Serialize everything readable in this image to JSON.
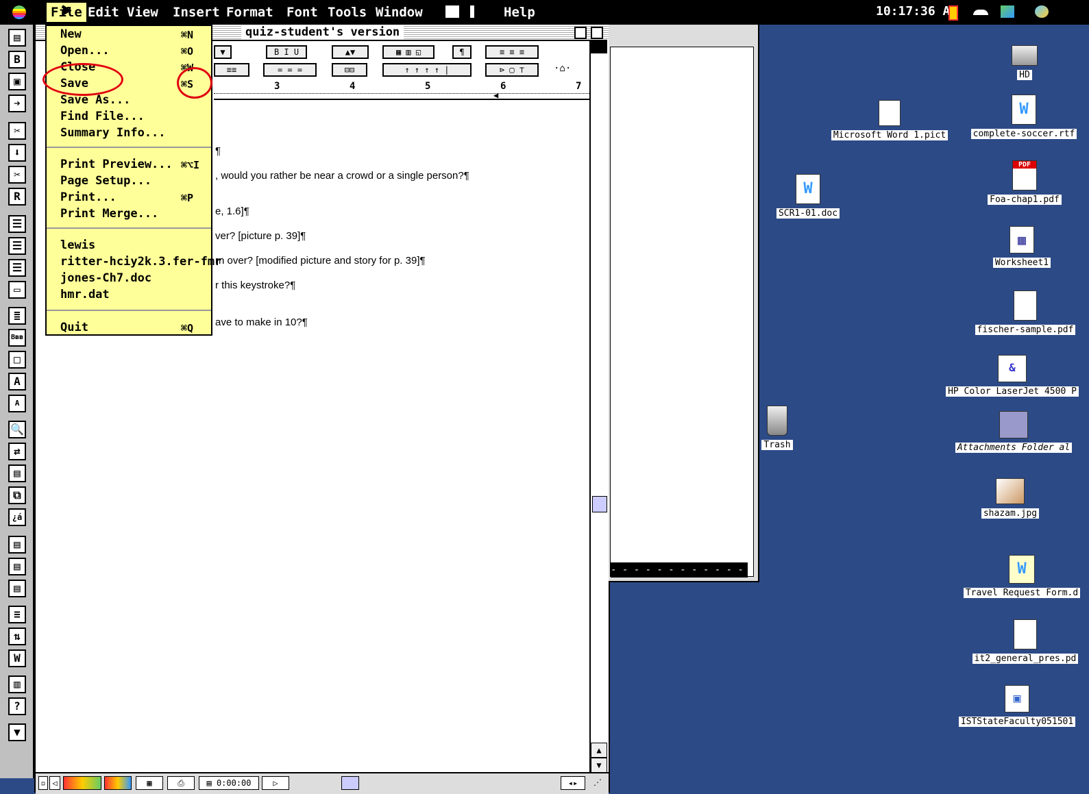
{
  "menubar": {
    "file": "File",
    "items": [
      "Edit",
      "View",
      "Insert",
      "Format",
      "Font",
      "Tools",
      "Window",
      "Help"
    ],
    "clock": "10:17:36 AM"
  },
  "palette": {
    "tools": [
      "B",
      "R",
      "Bʙʙ",
      "A",
      "A",
      "¿á",
      "?"
    ]
  },
  "window": {
    "title": "quiz-student's version"
  },
  "ruler": {
    "marks": [
      "3",
      "4",
      "5",
      "6",
      "7"
    ]
  },
  "document": {
    "lines": [
      "¶",
      ", would you rather be near a crowd or a single person?¶",
      "e, 1.6]¶",
      "ver?  [picture p. 39]¶",
      "rn over?  [modified picture and story for p. 39]¶",
      "r this keystroke?¶",
      "ave to make in 10?¶"
    ]
  },
  "statusbar": {
    "time": "0:00:00"
  },
  "filemenu": {
    "items": [
      {
        "label": "New",
        "key": "⌘N"
      },
      {
        "label": "Open...",
        "key": "⌘O"
      },
      {
        "label": "Close",
        "key": "⌘W"
      },
      {
        "label": "Save",
        "key": "⌘S"
      },
      {
        "label": "Save As...",
        "key": ""
      },
      {
        "label": "Find File...",
        "key": ""
      },
      {
        "label": "Summary Info...",
        "key": ""
      },
      {
        "label": "Print Preview...",
        "key": "⌘⌥I"
      },
      {
        "label": "Page Setup...",
        "key": ""
      },
      {
        "label": "Print...",
        "key": "⌘P"
      },
      {
        "label": "Print Merge...",
        "key": ""
      },
      {
        "label": "lewis",
        "key": ""
      },
      {
        "label": "ritter-hciy2k.3.fer-fmr",
        "key": ""
      },
      {
        "label": "jones-Ch7.doc",
        "key": ""
      },
      {
        "label": "hmr.dat",
        "key": ""
      },
      {
        "label": "Quit",
        "key": "⌘Q"
      }
    ]
  },
  "finder": {
    "dashes": "- - - - - - - - - - - - - - - - - - - - - - - - -"
  },
  "desktop": {
    "icons": [
      {
        "label": "HD",
        "kind": "drive-icon"
      },
      {
        "label": "Microsoft Word 1.pict",
        "kind": "pict-file-icon"
      },
      {
        "label": "complete-soccer.rtf",
        "kind": "word-doc-icon"
      },
      {
        "label": "SCR1-01.doc",
        "kind": "word-doc-icon"
      },
      {
        "label": "Foa-chap1.pdf",
        "kind": "pdf-file-icon"
      },
      {
        "label": "Worksheet1",
        "kind": "worksheet-icon"
      },
      {
        "label": "fischer-sample.pdf",
        "kind": "blank-file-icon"
      },
      {
        "label": "HP Color LaserJet 4500 P",
        "kind": "printer-icon"
      },
      {
        "label": "Trash",
        "kind": "trash-icon"
      },
      {
        "label": "Attachments Folder al",
        "kind": "folder-alias-icon"
      },
      {
        "label": "shazam.jpg",
        "kind": "image-file-icon"
      },
      {
        "label": "Travel Request Form.d",
        "kind": "word-doc-icon"
      },
      {
        "label": "it2_general_pres.pd",
        "kind": "blank-file-icon"
      },
      {
        "label": "ISTStateFaculty051501",
        "kind": "presentation-icon"
      }
    ]
  }
}
